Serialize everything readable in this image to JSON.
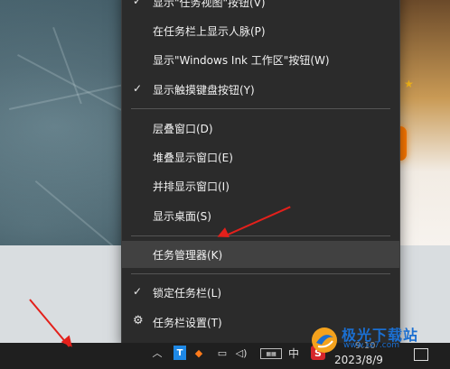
{
  "context_menu": {
    "items": [
      {
        "label": "显示\"任务视图\"按钮(V)",
        "checked": true
      },
      {
        "label": "在任务栏上显示人脉(P)",
        "checked": false
      },
      {
        "label": "显示\"Windows Ink 工作区\"按钮(W)",
        "checked": false
      },
      {
        "label": "显示触摸键盘按钮(Y)",
        "checked": true
      },
      {
        "label": "层叠窗口(D)",
        "checked": false
      },
      {
        "label": "堆叠显示窗口(E)",
        "checked": false
      },
      {
        "label": "并排显示窗口(I)",
        "checked": false
      },
      {
        "label": "显示桌面(S)",
        "checked": false
      },
      {
        "label": "任务管理器(K)",
        "checked": false,
        "highlighted": true
      },
      {
        "label": "锁定任务栏(L)",
        "checked": true
      },
      {
        "label": "任务栏设置(T)",
        "icon": "gear-icon"
      }
    ]
  },
  "taskbar": {
    "tray_ime": "中",
    "date": "2023/8/9",
    "time": "9:10"
  },
  "watermark": {
    "name": "极光下载站",
    "url": "www.xz7.com"
  },
  "colors": {
    "menu_bg": "#2b2b2b",
    "highlight": "#414141",
    "arrow": "#e3201b"
  }
}
